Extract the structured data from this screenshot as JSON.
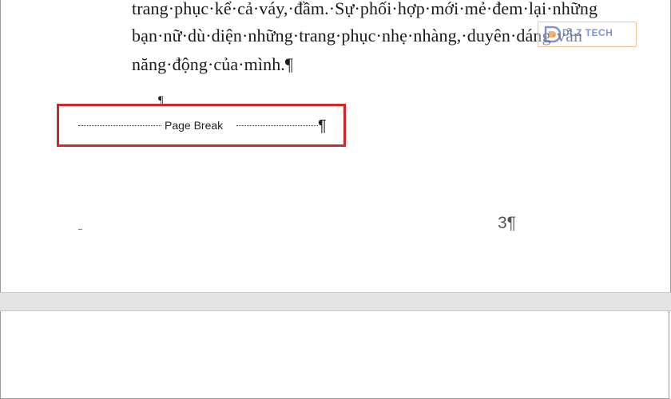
{
  "document": {
    "lines": [
      "trang·phục·kể·cả·váy,·đầm.·Sự·phối·hợp·mới·mẻ·đem·lại·những",
      "bạn·nữ·dù·diện·những·trang·phục·nhẹ·nhàng,·duyên·dáng·vẫn",
      "năng·động·của·mình.¶"
    ],
    "stray_mark": "¶",
    "page_break_label": "Page Break",
    "page_break_pilcrow": "¶",
    "page_number": "3¶"
  },
  "watermark": {
    "text": "DLZ TECH"
  },
  "colors": {
    "highlight_border": "#d0272d",
    "watermark_text": "#6a7fc8",
    "watermark_border": "#f2b880",
    "page_gap": "#e4e4e4"
  }
}
